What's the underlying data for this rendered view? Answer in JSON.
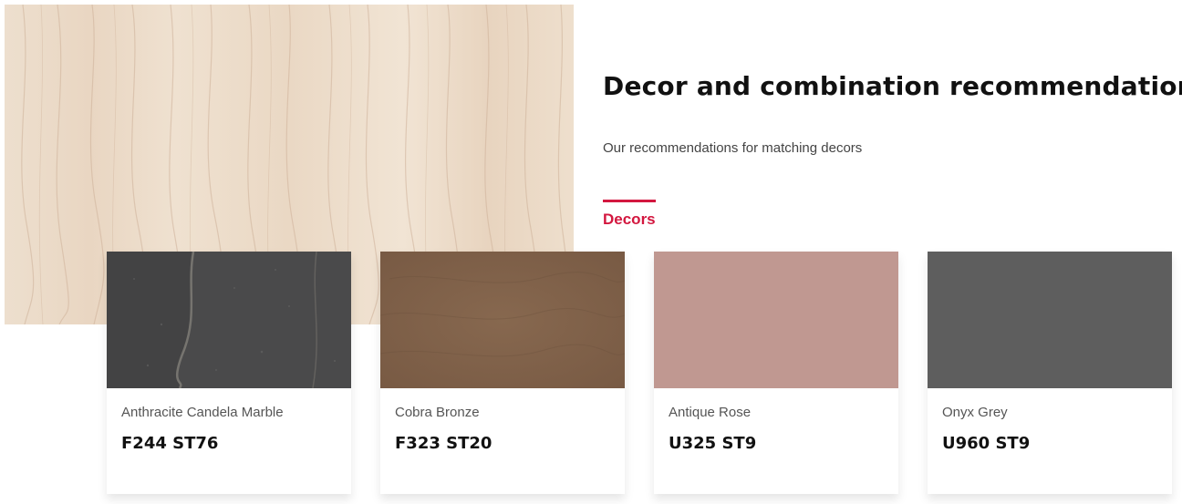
{
  "header": {
    "title": "Decor and combination recommendations",
    "subtitle": "Our recommendations for matching decors"
  },
  "tabs": [
    {
      "label": "Decors",
      "active": true
    }
  ],
  "colors": {
    "accent": "#d3173f",
    "hero_wood": "#efe0ce"
  },
  "cards": [
    {
      "name": "Anthracite Candela Marble",
      "code": "F244 ST76",
      "swatch_color": "#4a4a4a",
      "texture": "stone"
    },
    {
      "name": "Cobra Bronze",
      "code": "F323 ST20",
      "swatch_color": "#80614a",
      "texture": "metal"
    },
    {
      "name": "Antique Rose",
      "code": "U325 ST9",
      "swatch_color": "#c09891",
      "texture": "solid"
    },
    {
      "name": "Onyx Grey",
      "code": "U960 ST9",
      "swatch_color": "#5e5e5e",
      "texture": "solid"
    }
  ]
}
